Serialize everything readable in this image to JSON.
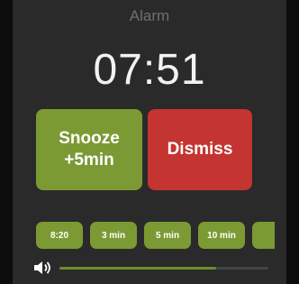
{
  "alarm": {
    "title": "Alarm",
    "time": "07:51"
  },
  "actions": {
    "snooze_line1": "Snooze",
    "snooze_line2": "+5min",
    "dismiss_label": "Dismiss"
  },
  "snooze_options": [
    "8:20",
    "3 min",
    "5 min",
    "10 min",
    ""
  ],
  "volume": {
    "icon": "speaker-icon",
    "level": 0.75
  },
  "colors": {
    "snooze": "#7c9a34",
    "dismiss": "#c43430",
    "background": "#2a2a2a",
    "volume_fill": "#6a8f2c"
  }
}
